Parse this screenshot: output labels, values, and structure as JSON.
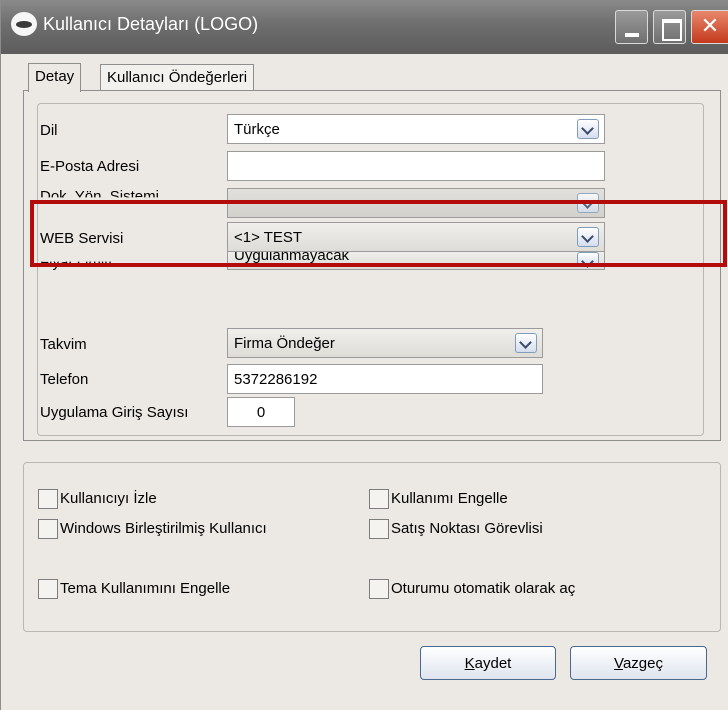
{
  "window": {
    "title": "Kullanıcı Detayları (LOGO)",
    "close_glyph": "✕"
  },
  "tabs": [
    {
      "label": "Detay",
      "active": true
    },
    {
      "label": "Kullanıcı Öndeğerleri",
      "active": false
    }
  ],
  "detail": {
    "dil_label": "Dil",
    "dil_value": "Türkçe",
    "eposta_label": "E-Posta Adresi",
    "eposta_value": "",
    "dok_label": "Dok. Yön. Sistemi",
    "dok_value": "",
    "web_label": "WEB Servisi",
    "web_value": "<1> TEST",
    "fiyat_label": "Fiyat Limiti",
    "fiyat_value": "Uygulanmayacak",
    "takvim_label": "Takvim",
    "takvim_value": "Firma Öndeğer",
    "telefon_label": "Telefon",
    "telefon_value": "5372286192",
    "giris_label": "Uygulama Giriş Sayısı",
    "giris_value": "0"
  },
  "options": {
    "izle": {
      "label": "Kullanıcıyı İzle",
      "checked": false
    },
    "engelle": {
      "label": "Kullanımı Engelle",
      "checked": false
    },
    "windows": {
      "label": "Windows Birleştirilmiş Kullanıcı",
      "checked": false
    },
    "satis": {
      "label": "Satış Noktası Görevlisi",
      "checked": false
    },
    "tema": {
      "label": "Tema Kullanımını Engelle",
      "checked": false
    },
    "oturum": {
      "label": "Oturumu otomatik olarak aç",
      "checked": false
    }
  },
  "buttons": {
    "save_mnemonic": "K",
    "save_rest": "aydet",
    "cancel_mnemonic": "V",
    "cancel_rest": "azgeç"
  },
  "colors": {
    "highlight": "#b40b0b",
    "titlebar": "#6e6e6e",
    "close_button": "#c43a1d"
  }
}
